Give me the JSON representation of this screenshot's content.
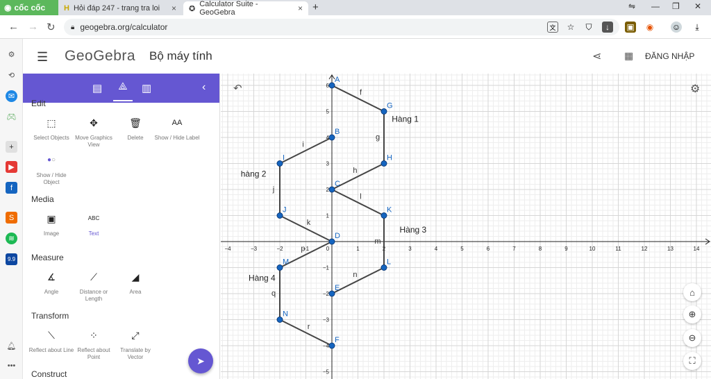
{
  "browser": {
    "brand": "cốc cốc",
    "tabs": [
      {
        "title": "Hỏi đáp 247 - trang tra loi",
        "icon": "h-icon"
      },
      {
        "title": "Calculator Suite - GeoGebra",
        "icon": "geogebra-icon"
      }
    ],
    "new_tab": "+",
    "url": "geogebra.org/calculator"
  },
  "app": {
    "logo": "GeoGebra",
    "title": "Bộ máy tính",
    "login": "ĐĂNG NHẬP"
  },
  "panel": {
    "sections": {
      "edit": "Edit",
      "media": "Media",
      "measure": "Measure",
      "transform": "Transform",
      "construct": "Construct"
    },
    "edit_tools": [
      "Select Objects",
      "Move Graphics View",
      "Delete",
      "Show / Hide Label",
      "Show / Hide Object"
    ],
    "media_tools": [
      "Image",
      "Text"
    ],
    "measure_tools": [
      "Angle",
      "Distance or Length",
      "Area"
    ],
    "transform_tools": [
      "Reflect about Line",
      "Reflect about Point",
      "Translate by Vector"
    ]
  },
  "colors": {
    "accent": "#6557d2",
    "point": "#1565c0",
    "segment": "#444444"
  },
  "chart_data": {
    "type": "scatter",
    "xlim": [
      -4,
      14
    ],
    "ylim": [
      -5,
      6
    ],
    "grid": true,
    "points": [
      {
        "name": "A",
        "x": 0,
        "y": 6
      },
      {
        "name": "G",
        "x": 2,
        "y": 5
      },
      {
        "name": "B",
        "x": 0,
        "y": 4
      },
      {
        "name": "H",
        "x": 2,
        "y": 3
      },
      {
        "name": "I",
        "x": -2,
        "y": 3
      },
      {
        "name": "C",
        "x": 0,
        "y": 2
      },
      {
        "name": "K",
        "x": 2,
        "y": 1
      },
      {
        "name": "J",
        "x": -2,
        "y": 1
      },
      {
        "name": "D",
        "x": 0,
        "y": 0
      },
      {
        "name": "L",
        "x": 2,
        "y": -1
      },
      {
        "name": "M",
        "x": -2,
        "y": -1
      },
      {
        "name": "E",
        "x": 0,
        "y": -2
      },
      {
        "name": "N",
        "x": -2,
        "y": -3
      },
      {
        "name": "F",
        "x": 0,
        "y": -4
      }
    ],
    "segments": [
      {
        "name": "f",
        "from": "A",
        "to": "G"
      },
      {
        "name": "g",
        "from": "G",
        "to": "H"
      },
      {
        "name": "h",
        "from": "H",
        "to": "C"
      },
      {
        "name": "i",
        "from": "B",
        "to": "I"
      },
      {
        "name": "j",
        "from": "I",
        "to": "J"
      },
      {
        "name": "k",
        "from": "J",
        "to": "D"
      },
      {
        "name": "l",
        "from": "C",
        "to": "K"
      },
      {
        "name": "m",
        "from": "K",
        "to": "L"
      },
      {
        "name": "n",
        "from": "L",
        "to": "E"
      },
      {
        "name": "p",
        "from": "D",
        "to": "M"
      },
      {
        "name": "q",
        "from": "M",
        "to": "N"
      },
      {
        "name": "r",
        "from": "N",
        "to": "F"
      }
    ],
    "texts": [
      {
        "text": "Hàng 1",
        "x": 2.3,
        "y": 4.6
      },
      {
        "text": "hàng 2",
        "x": -3.5,
        "y": 2.5
      },
      {
        "text": "Hàng 3",
        "x": 2.6,
        "y": 0.35
      },
      {
        "text": "Hàng 4",
        "x": -3.2,
        "y": -1.5
      }
    ],
    "x_ticks": [
      -4,
      -3,
      -2,
      -1,
      1,
      2,
      3,
      4,
      5,
      6,
      7,
      8,
      9,
      10,
      11,
      12,
      13,
      14
    ],
    "y_ticks": [
      -5,
      -4,
      -3,
      -2,
      -1,
      1,
      2,
      3,
      4,
      5,
      6
    ]
  }
}
